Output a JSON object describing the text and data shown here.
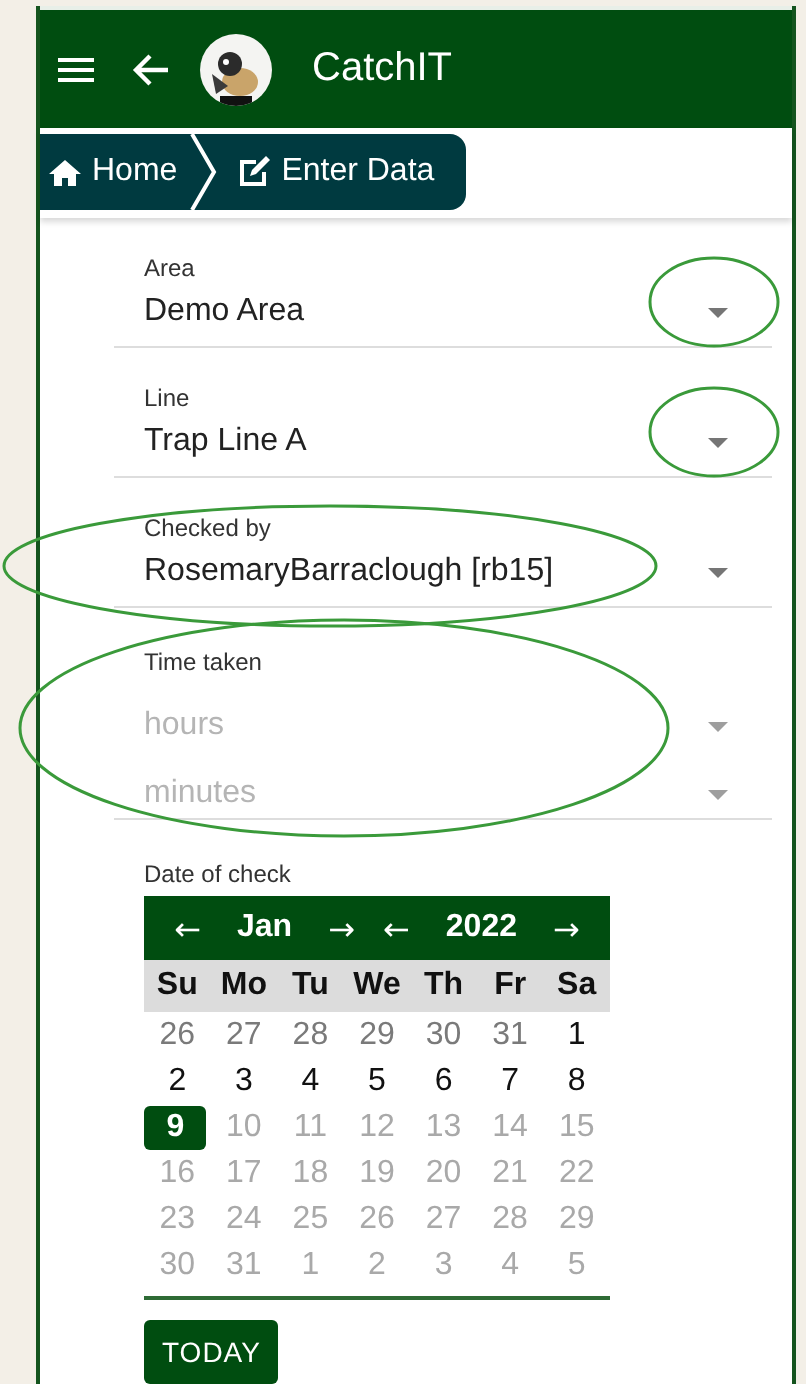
{
  "app_bar": {
    "title": "CatchIT"
  },
  "breadcrumbs": [
    {
      "label": "Home"
    },
    {
      "label": "Enter Data"
    }
  ],
  "selects": [
    {
      "label": "Area",
      "value": "Demo Area",
      "caret_circled": true,
      "text_circled": false
    },
    {
      "label": "Line",
      "value": "Trap Line A",
      "caret_circled": true,
      "text_circled": false
    },
    {
      "label": "Checked by",
      "value": "RosemaryBarraclough [rb15]",
      "caret_circled": false,
      "text_circled": true
    }
  ],
  "time_taken": {
    "label": "Time taken",
    "circled": true,
    "selects": [
      {
        "placeholder": "hours"
      },
      {
        "placeholder": "minutes"
      }
    ]
  },
  "date_picker": {
    "label": "Date of check",
    "prev_month": "←",
    "month": "Jan",
    "next_month": "→",
    "prev_year": "←",
    "year": "2022",
    "next_year": "→",
    "weekdays": [
      "Su",
      "Mo",
      "Tu",
      "We",
      "Th",
      "Fr",
      "Sa"
    ],
    "weeks": [
      [
        {
          "label": "26",
          "kind": "outside",
          "selected": false
        },
        {
          "label": "27",
          "kind": "outside",
          "selected": false
        },
        {
          "label": "28",
          "kind": "outside",
          "selected": false
        },
        {
          "label": "29",
          "kind": "outside",
          "selected": false
        },
        {
          "label": "30",
          "kind": "outside",
          "selected": false
        },
        {
          "label": "31",
          "kind": "outside",
          "selected": false
        },
        {
          "label": "1",
          "kind": "enabled",
          "selected": false
        }
      ],
      [
        {
          "label": "2",
          "kind": "enabled",
          "selected": false
        },
        {
          "label": "3",
          "kind": "enabled",
          "selected": false
        },
        {
          "label": "4",
          "kind": "enabled",
          "selected": false
        },
        {
          "label": "5",
          "kind": "enabled",
          "selected": false
        },
        {
          "label": "6",
          "kind": "enabled",
          "selected": false
        },
        {
          "label": "7",
          "kind": "enabled",
          "selected": false
        },
        {
          "label": "8",
          "kind": "enabled",
          "selected": false
        }
      ],
      [
        {
          "label": "9",
          "kind": "enabled",
          "selected": true
        },
        {
          "label": "10",
          "kind": "disabled",
          "selected": false
        },
        {
          "label": "11",
          "kind": "disabled",
          "selected": false
        },
        {
          "label": "12",
          "kind": "disabled",
          "selected": false
        },
        {
          "label": "13",
          "kind": "disabled",
          "selected": false
        },
        {
          "label": "14",
          "kind": "disabled",
          "selected": false
        },
        {
          "label": "15",
          "kind": "disabled",
          "selected": false
        }
      ],
      [
        {
          "label": "16",
          "kind": "disabled",
          "selected": false
        },
        {
          "label": "17",
          "kind": "disabled",
          "selected": false
        },
        {
          "label": "18",
          "kind": "disabled",
          "selected": false
        },
        {
          "label": "19",
          "kind": "disabled",
          "selected": false
        },
        {
          "label": "20",
          "kind": "disabled",
          "selected": false
        },
        {
          "label": "21",
          "kind": "disabled",
          "selected": false
        },
        {
          "label": "22",
          "kind": "disabled",
          "selected": false
        }
      ],
      [
        {
          "label": "23",
          "kind": "disabled",
          "selected": false
        },
        {
          "label": "24",
          "kind": "disabled",
          "selected": false
        },
        {
          "label": "25",
          "kind": "disabled",
          "selected": false
        },
        {
          "label": "26",
          "kind": "disabled",
          "selected": false
        },
        {
          "label": "27",
          "kind": "disabled",
          "selected": false
        },
        {
          "label": "28",
          "kind": "disabled",
          "selected": false
        },
        {
          "label": "29",
          "kind": "disabled",
          "selected": false
        }
      ],
      [
        {
          "label": "30",
          "kind": "disabled",
          "selected": false
        },
        {
          "label": "31",
          "kind": "disabled",
          "selected": false
        },
        {
          "label": "1",
          "kind": "disabled",
          "selected": false
        },
        {
          "label": "2",
          "kind": "disabled",
          "selected": false
        },
        {
          "label": "3",
          "kind": "disabled",
          "selected": false
        },
        {
          "label": "4",
          "kind": "disabled",
          "selected": false
        },
        {
          "label": "5",
          "kind": "disabled",
          "selected": false
        }
      ]
    ],
    "today_button": "TODAY"
  }
}
